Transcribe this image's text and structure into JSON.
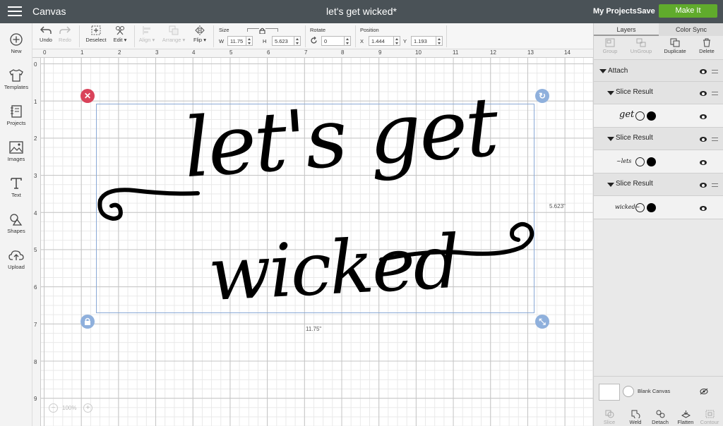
{
  "topbar": {
    "app_title": "Canvas",
    "doc_title": "let's get wicked*",
    "my_projects": "My Projects",
    "save": "Save",
    "make_it": "Make It",
    "make_it_color": "#60ab2c"
  },
  "toolbar": {
    "undo": "Undo",
    "redo": "Redo",
    "deselect": "Deselect",
    "edit": "Edit",
    "align": "Align",
    "arrange": "Arrange",
    "flip": "Flip",
    "size_label": "Size",
    "w_label": "W",
    "w_value": "11.75",
    "h_label": "H",
    "h_value": "5.623",
    "rotate_label": "Rotate",
    "rotate_value": "0",
    "position_label": "Position",
    "x_label": "X",
    "x_value": "1.444",
    "y_label": "Y",
    "y_value": "1.193"
  },
  "sidebar": {
    "items": [
      {
        "label": "New",
        "icon": "plus-circle-icon"
      },
      {
        "label": "Templates",
        "icon": "tshirt-icon"
      },
      {
        "label": "Projects",
        "icon": "notebook-icon"
      },
      {
        "label": "Images",
        "icon": "image-icon"
      },
      {
        "label": "Text",
        "icon": "text-icon"
      },
      {
        "label": "Shapes",
        "icon": "shapes-icon"
      },
      {
        "label": "Upload",
        "icon": "cloud-upload-icon"
      }
    ]
  },
  "rulers": {
    "top": [
      "0",
      "1",
      "2",
      "3",
      "4",
      "5",
      "6",
      "7",
      "8",
      "9",
      "10",
      "11",
      "12",
      "13",
      "14"
    ],
    "left": [
      "0",
      "1",
      "2",
      "3",
      "4",
      "5",
      "6",
      "7",
      "8",
      "9"
    ]
  },
  "canvas": {
    "design_line1": "let's get",
    "design_line2": "wicked",
    "width_label": "11.75\"",
    "height_label": "5.623\"",
    "zoom": "100%",
    "selection_color": "#8aa9d6",
    "delete_handle_color": "#d9435a",
    "handle_color": "#8fb0dc"
  },
  "panel": {
    "tabs": [
      "Layers",
      "Color Sync"
    ],
    "actions": [
      "Group",
      "UnGroup",
      "Duplicate",
      "Delete"
    ],
    "attach_label": "Attach",
    "layers": [
      {
        "label": "Slice Result",
        "thumb": "get"
      },
      {
        "label": "Slice Result",
        "thumb": "~lets"
      },
      {
        "label": "Slice Result",
        "thumb": "wicked~"
      }
    ],
    "blank_canvas": "Blank Canvas",
    "bottom_tools": [
      "Slice",
      "Weld",
      "Detach",
      "Flatten",
      "Contour"
    ]
  }
}
